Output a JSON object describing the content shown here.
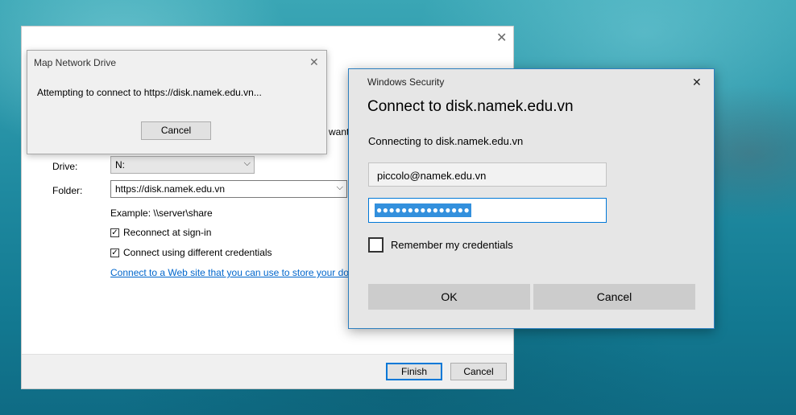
{
  "wizard": {
    "partial_text": "want",
    "drive_label": "Drive:",
    "drive_value": "N:",
    "folder_label": "Folder:",
    "folder_value": "https://disk.namek.edu.vn",
    "example_text": "Example: \\\\server\\share",
    "reconnect_label": "Reconnect at sign-in",
    "different_credentials_label": "Connect using different credentials",
    "web_link": "Connect to a Web site that you can use to store your docu",
    "finish_label": "Finish",
    "cancel_label": "Cancel"
  },
  "progress_dialog": {
    "title": "Map Network Drive",
    "message": "Attempting to connect to https://disk.namek.edu.vn...",
    "cancel_label": "Cancel"
  },
  "security_dialog": {
    "title": "Windows Security",
    "heading": "Connect to disk.namek.edu.vn",
    "subtext": "Connecting to disk.namek.edu.vn",
    "username_value": "piccolo@namek.edu.vn",
    "password_mask": "●●●●●●●●●●●●●●●",
    "remember_label": "Remember my credentials",
    "ok_label": "OK",
    "cancel_label": "Cancel"
  },
  "icons": {
    "close": "✕",
    "dropdown": "⌵",
    "check": "✓"
  },
  "colors": {
    "accent": "#0078d7",
    "link": "#0066cc",
    "selection": "#3390dd"
  }
}
